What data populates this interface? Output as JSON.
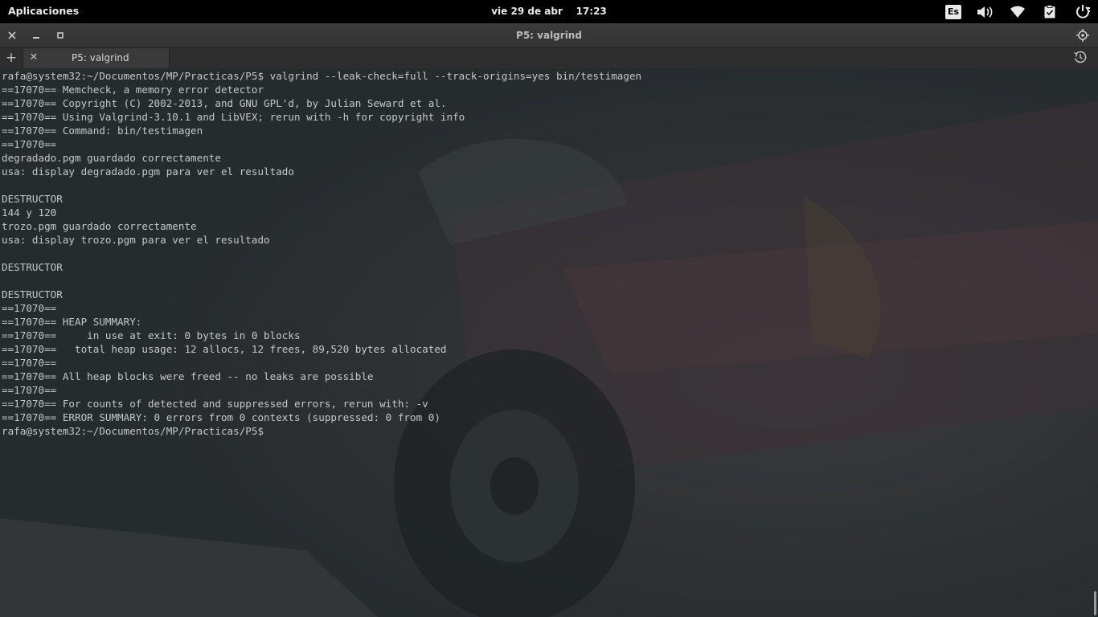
{
  "panel": {
    "apps_label": "Aplicaciones",
    "clock": "vie 29 de abr    17:23",
    "lang": "Es"
  },
  "window": {
    "title": "P5: valgrind"
  },
  "tabs": [
    {
      "label": "P5: valgrind"
    }
  ],
  "terminal": {
    "lines": [
      "rafa@system32:~/Documentos/MP/Practicas/P5$ valgrind --leak-check=full --track-origins=yes bin/testimagen",
      "==17070== Memcheck, a memory error detector",
      "==17070== Copyright (C) 2002-2013, and GNU GPL'd, by Julian Seward et al.",
      "==17070== Using Valgrind-3.10.1 and LibVEX; rerun with -h for copyright info",
      "==17070== Command: bin/testimagen",
      "==17070==",
      "degradado.pgm guardado correctamente",
      "usa: display degradado.pgm para ver el resultado",
      "",
      "DESTRUCTOR",
      "144 y 120",
      "trozo.pgm guardado correctamente",
      "usa: display trozo.pgm para ver el resultado",
      "",
      "DESTRUCTOR",
      "",
      "DESTRUCTOR",
      "==17070==",
      "==17070== HEAP SUMMARY:",
      "==17070==     in use at exit: 0 bytes in 0 blocks",
      "==17070==   total heap usage: 12 allocs, 12 frees, 89,520 bytes allocated",
      "==17070==",
      "==17070== All heap blocks were freed -- no leaks are possible",
      "==17070==",
      "==17070== For counts of detected and suppressed errors, rerun with: -v",
      "==17070== ERROR SUMMARY: 0 errors from 0 contexts (suppressed: 0 from 0)",
      "rafa@system32:~/Documentos/MP/Practicas/P5$"
    ]
  },
  "colors": {
    "terminal_bg": "#262b2e",
    "terminal_text": "#c4c8ca",
    "panel_bg": "#000000"
  },
  "icons": [
    "close-icon",
    "minimize-icon",
    "maximize-icon",
    "settings-icon",
    "add-tab-icon",
    "history-icon",
    "volume-icon",
    "wifi-icon",
    "clipboard-icon",
    "power-icon"
  ]
}
